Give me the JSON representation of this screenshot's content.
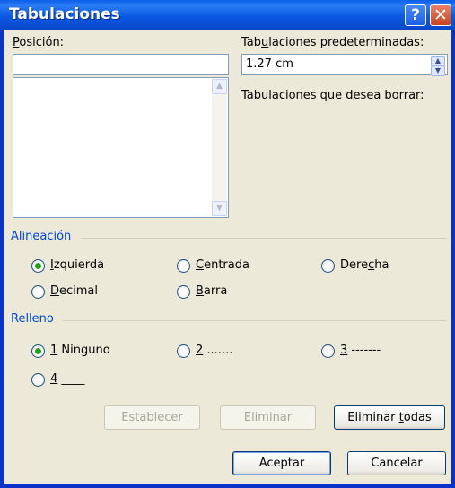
{
  "title": "Tabulaciones",
  "title_buttons": {
    "help": "?",
    "close": "✕"
  },
  "position": {
    "label": "Posición:",
    "value": ""
  },
  "default_tabs": {
    "label": "Tabulaciones predeterminadas:",
    "value": "1.27 cm"
  },
  "tabs_to_clear": {
    "label": "Tabulaciones que desea borrar:"
  },
  "alignment": {
    "label": "Alineación",
    "options": [
      "Izquierda",
      "Centrada",
      "Derecha",
      "Decimal",
      "Barra"
    ],
    "selected": "Izquierda"
  },
  "leader": {
    "label": "Relleno",
    "options": [
      "1 Ninguno",
      "2 .......",
      "3 -------",
      "4 ____"
    ],
    "selected": "1 Ninguno"
  },
  "buttons": {
    "set": "Establecer",
    "clear": "Eliminar",
    "clear_all": "Eliminar todas",
    "ok": "Aceptar",
    "cancel": "Cancelar"
  },
  "colors": {
    "titlebar": "#0a58e2",
    "client": "#ece9d8",
    "group_label": "#0046d5",
    "radio_dot": "#21a121"
  }
}
